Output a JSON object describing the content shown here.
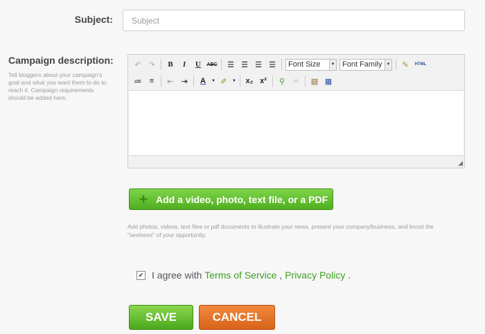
{
  "subject": {
    "label": "Subject:",
    "placeholder": "Subject"
  },
  "description": {
    "label": "Campaign description:",
    "hint": "Tell bloggers about your campaign's goal and what you want them to do to reach it. Campaign requirements should be added here."
  },
  "editor": {
    "toolbar": {
      "bold": "B",
      "italic": "I",
      "underline": "U",
      "strike": "ABC",
      "font_size": "Font Size",
      "font_family": "Font Family",
      "html": "HTML",
      "subscript": "x₂",
      "superscript": "x²"
    }
  },
  "attach": {
    "label": "Add a video, photo, text file, or a PDF",
    "hint": "Add photos, videos, text files or pdf documents to illustrate your news, present your company/business, and boost the \"sexiness\" of your opportunity."
  },
  "agree": {
    "prefix": "I agree with",
    "terms": "Terms of Service",
    "separator": ",",
    "privacy": "Privacy Policy",
    "suffix": ".",
    "checked": true
  },
  "actions": {
    "save": "SAVE",
    "cancel": "CANCEL"
  },
  "colors": {
    "green": "#4fae1e",
    "orange": "#e06a22",
    "link": "#3b9e1f"
  }
}
